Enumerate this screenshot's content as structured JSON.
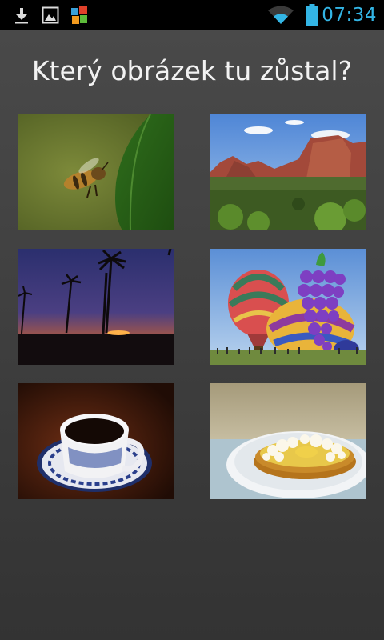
{
  "status_bar": {
    "time": "07:34",
    "icons": [
      "download-icon",
      "gallery-icon",
      "app-notification-icon",
      "wifi-icon",
      "battery-icon"
    ],
    "accent_color": "#33b5e5"
  },
  "screen": {
    "title": "Který obrázek tu zůstal?",
    "background_color": "#444444",
    "title_color": "#f2f2f2"
  },
  "choices": [
    {
      "id": "bee",
      "image": "bee-on-leaf-photo"
    },
    {
      "id": "canyon",
      "image": "red-rock-canyon-photo"
    },
    {
      "id": "palms",
      "image": "palm-sunset-photo"
    },
    {
      "id": "balloons",
      "image": "hot-air-balloons-photo"
    },
    {
      "id": "coffee",
      "image": "coffee-cup-photo"
    },
    {
      "id": "tart",
      "image": "meringue-tart-photo"
    }
  ]
}
